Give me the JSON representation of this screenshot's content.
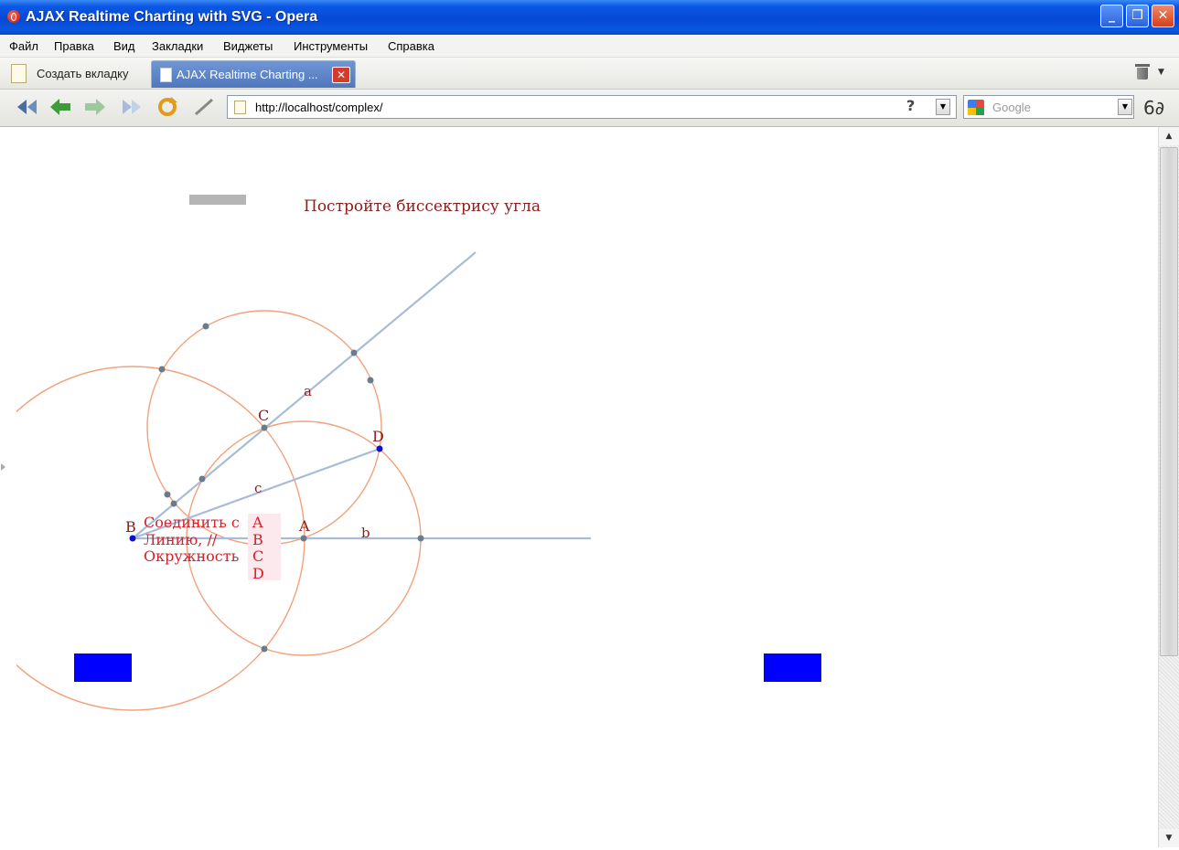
{
  "window": {
    "title": "AJAX Realtime Charting with SVG - Opera",
    "minimize": "_",
    "maximize": "❐",
    "close": "✕"
  },
  "menu": [
    "Файл",
    "Правка",
    "Вид",
    "Закладки",
    "Виджеты",
    "Инструменты",
    "Справка"
  ],
  "tabs": {
    "new_tab_label": "Создать вкладку",
    "active_tab_label": "AJAX Realtime Charting ...",
    "close_glyph": "✕"
  },
  "toolbar": {
    "url": "http://localhost/complex/",
    "help_glyph": "?",
    "search_placeholder": "Google",
    "dropdown_glyph": "▼",
    "reading_glyph": "6∂"
  },
  "canvas": {
    "instruction": "Постройте биссектрису угла",
    "point_labels": {
      "A": "A",
      "B": "B",
      "C": "C",
      "D": "D"
    },
    "segment_labels": {
      "a": "a",
      "b": "b",
      "c": "c"
    },
    "context_menu": {
      "actions": [
        "Соединить с",
        "Линию, //",
        "Окружность"
      ],
      "targets": [
        "A",
        "B",
        "C",
        "D"
      ]
    },
    "colors": {
      "circle": "#f4a07a",
      "line": "#a9bcd6",
      "point": "#6b7b8c",
      "active_point": "#1010cc",
      "label": "#8b1d1d",
      "menu_text": "#d4202a",
      "menu_bg": "#fbe9ee",
      "button_blue": "#0000ff",
      "grey_bar": "#b5b5b5"
    }
  },
  "scroll": {
    "up_glyph": "▲",
    "down_glyph": "▼"
  }
}
